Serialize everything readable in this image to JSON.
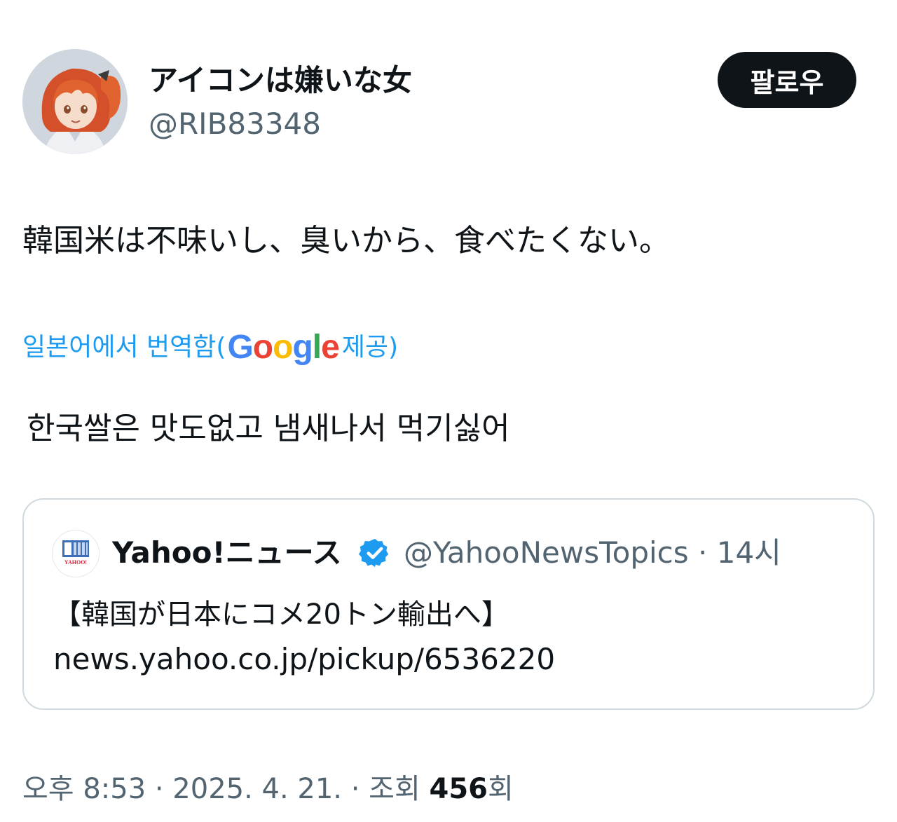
{
  "author": {
    "display_name": "アイコンは嫌いな女",
    "handle": "@RIB83348",
    "avatar_icon": "anime-character-avatar"
  },
  "follow_button": {
    "label": "팔로우"
  },
  "tweet": {
    "text": "韓国米は不味いし、臭いから、食べたくない。",
    "translate": {
      "prefix": "일본어에서 번역함(",
      "google_letters": [
        {
          "char": "G",
          "color": "#4285f4"
        },
        {
          "char": "o",
          "color": "#ea4335"
        },
        {
          "char": "o",
          "color": "#fbbc05"
        },
        {
          "char": "g",
          "color": "#4285f4"
        },
        {
          "char": "l",
          "color": "#34a853"
        },
        {
          "char": "e",
          "color": "#ea4335"
        }
      ],
      "suffix": " 제공)"
    },
    "translated_text": "한국쌀은 맛도없고 냄새나서 먹기싫어"
  },
  "quoted_tweet": {
    "name": "Yahoo!ニュース",
    "verified": true,
    "handle": "@YahooNewsTopics",
    "separator": "·",
    "time": "14시",
    "title": "【韓国が日本にコメ20トン輸出へ】",
    "link": "news.yahoo.co.jp/pickup/6536220",
    "avatar_icon": "yahoo-news-icon",
    "avatar_text": "YAHOO!"
  },
  "footer": {
    "time": "오후 8:53",
    "date": "2025. 4. 21.",
    "views_label": "조회",
    "views_count": "456",
    "views_suffix": "회",
    "separator": "·"
  },
  "colors": {
    "text_primary": "#0f1419",
    "text_secondary": "#536471",
    "link_blue": "#1d9bf0",
    "verified_blue": "#1d9bf0",
    "border": "#cfd9de"
  }
}
